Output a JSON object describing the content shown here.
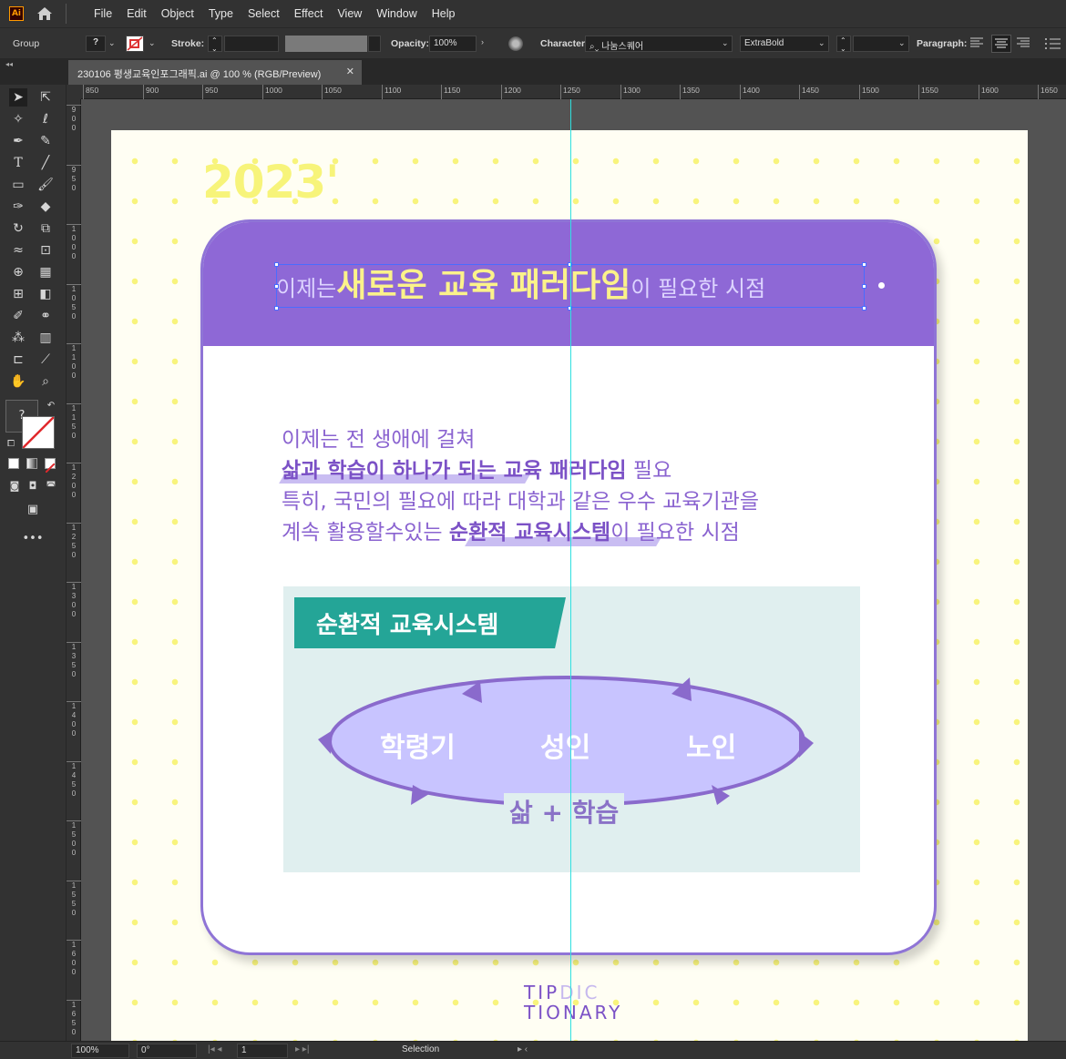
{
  "app": {
    "logo": "Ai"
  },
  "menu": [
    "File",
    "Edit",
    "Object",
    "Type",
    "Select",
    "Effect",
    "View",
    "Window",
    "Help"
  ],
  "control": {
    "selection_type": "Group",
    "fill_label": "?",
    "stroke_label": "Stroke:",
    "opacity_label": "Opacity:",
    "opacity_value": "100%",
    "character_label": "Character:",
    "font_family": "나눔스퀘어",
    "font_style": "ExtraBold",
    "paragraph_label": "Paragraph:"
  },
  "document": {
    "tab_title": "230106 평생교육인포그래픽.ai @ 100 % (RGB/Preview)",
    "close": "✕"
  },
  "ruler": {
    "h_labels": [
      "850",
      "900",
      "950",
      "1000",
      "1050",
      "1100",
      "1150",
      "1200",
      "1250",
      "1300",
      "1350",
      "1400",
      "1450",
      "1500",
      "1550",
      "1600",
      "1650"
    ],
    "v_labels": [
      "900",
      "950",
      "1000",
      "1050",
      "1100",
      "1150",
      "1200",
      "1250",
      "1300",
      "1350",
      "1400",
      "1450",
      "1500",
      "1550",
      "1600",
      "1650"
    ]
  },
  "artwork": {
    "year": "2023'",
    "title_pre": "이제는",
    "title_main": "새로운 교육 패러다임",
    "title_post": "이 필요한 시점",
    "lines": [
      {
        "plain": "이제는 전 생애에 걸쳐",
        "bold": "",
        "rest": ""
      },
      {
        "plain": "",
        "bold": "삶과 학습이 하나가 되는 교육 패러다임",
        "rest": " 필요"
      },
      {
        "plain": "특히, 국민의 필요에 따라 대학과 같은 우수 교육기관을",
        "bold": "",
        "rest": ""
      },
      {
        "plain": "계속 활용할수있는 ",
        "bold": "순환적 교육시스템",
        "rest": "이 필요한 시점"
      }
    ],
    "system_tag": "순환적 교육시스템",
    "cycle_labels": [
      "학령기",
      "성인",
      "노인"
    ],
    "cycle_bottom": "삶 + 학습",
    "brand_line1_a": "TIP",
    "brand_line1_b": "DIC",
    "brand_line2": "TIONARY"
  },
  "status": {
    "zoom": "100%",
    "rotation": "0°",
    "artboard": "1",
    "tool": "Selection"
  },
  "colors": {
    "header_purple": "#8e68d6",
    "title_yellow": "#fbf28a",
    "body_purple": "#8a63d0",
    "teal": "#24a597",
    "cycle_fill": "#c8c4ff",
    "cycle_stroke": "#8a6acc",
    "dot_yellow": "#f8f47c"
  }
}
